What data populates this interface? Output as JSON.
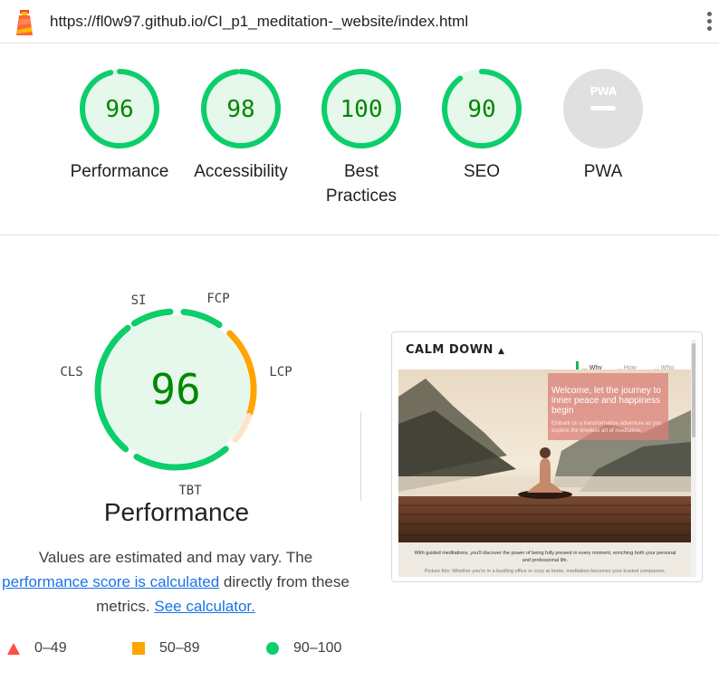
{
  "header": {
    "url": "https://fl0w97.github.io/CI_p1_meditation-_website/index.html"
  },
  "colors": {
    "pass": "#0cce6b",
    "pass_fill": "#e6f7ec",
    "pass_text": "#008800",
    "average": "#ffa400",
    "fail": "#ff4e42",
    "na": "#e0e0e0",
    "link": "#1a73e8"
  },
  "categories": [
    {
      "label": "Performance",
      "score": "96",
      "value": 96
    },
    {
      "label": "Accessibility",
      "score": "98",
      "value": 98
    },
    {
      "label": "Best Practices",
      "score": "100",
      "value": 100
    },
    {
      "label": "SEO",
      "score": "90",
      "value": 90
    },
    {
      "label": "PWA",
      "score": "PWA",
      "value": null
    }
  ],
  "performance": {
    "score": "96",
    "title": "Performance",
    "metrics": [
      "SI",
      "FCP",
      "LCP",
      "TBT",
      "CLS"
    ],
    "note_prefix": "Values are estimated and may vary. The",
    "note_link": "performance score is calculated",
    "note_middle": "directly from these metrics.",
    "note_link2": "See calculator."
  },
  "legend": [
    {
      "icon": "triangle-icon",
      "range": "0–49"
    },
    {
      "icon": "square-icon",
      "range": "50–89"
    },
    {
      "icon": "circle-icon",
      "range": "90–100"
    }
  ],
  "thumbnail": {
    "brand": "CALM DOWN",
    "nav": [
      "... Why",
      "... How",
      "... Who"
    ],
    "hero_heading": "Welcome, let the journey to inner peace and happiness begin",
    "hero_sub": "Embark on a transformative adventure as you explore the timeless art of meditation.",
    "body_text": "With guided meditations, you'll discover the power of being fully present in every moment, enriching both your personal and professional life.",
    "body_text2": "Picture this: Whether you're in a bustling office or cozy at home, meditation becomes your trusted companion."
  }
}
